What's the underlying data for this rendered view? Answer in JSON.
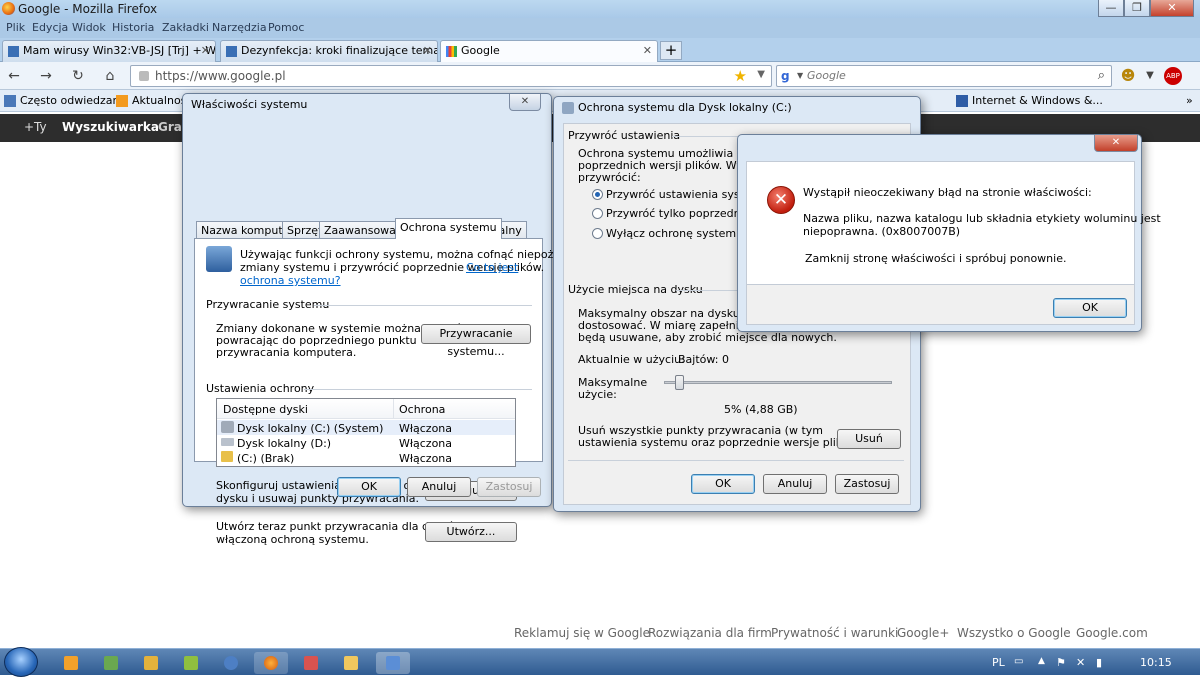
{
  "window": {
    "title": "Google - Mozilla Firefox"
  },
  "menu": [
    "Plik",
    "Edycja",
    "Widok",
    "Historia",
    "Zakładki",
    "Narzędzia",
    "Pomoc"
  ],
  "tabs": [
    {
      "label": "Mam wirusy Win32:VB-JSJ [Trj] + Win..."
    },
    {
      "label": "Dezynfekcja: kroki finalizujące temat ..."
    },
    {
      "label": "Google"
    }
  ],
  "nav": {
    "url": "https://www.google.pl",
    "search_placeholder": "Google"
  },
  "bookmarks": [
    "Często odwiedzane",
    "Aktualności",
    "Internet & Windows &..."
  ],
  "gbar": {
    "plus": "+Ty",
    "search": "Wyszukiwarka",
    "graf": "Graf"
  },
  "footer": [
    "Reklamuj się w Google",
    "Rozwiązania dla firm",
    "Prywatność i warunki",
    "Google+",
    "Wszystko o Google",
    "Google.com"
  ],
  "sysprops": {
    "title": "Właściwości systemu",
    "tabs": [
      "Nazwa komputera",
      "Sprzęt",
      "Zaawansowane",
      "Ochrona systemu",
      "Zdalny"
    ],
    "intro_1": "Używając funkcji ochrony systemu, można cofnąć niepożądane",
    "intro_2": "zmiany systemu i przywrócić poprzednie wersje plików.",
    "intro_link_1": "Co to jest",
    "intro_link_2": "ochrona systemu?",
    "restore_group": "Przywracanie systemu",
    "restore_text_1": "Zmiany dokonane w systemie można cofnąć,",
    "restore_text_2": "powracając do poprzedniego punktu",
    "restore_text_3": "przywracania komputera.",
    "restore_button": "Przywracanie systemu...",
    "prot_group": "Ustawienia ochrony",
    "col_drives": "Dostępne dyski",
    "col_prot": "Ochrona",
    "drives": [
      {
        "name": "Dysk lokalny (C:) (System)",
        "prot": "Włączona"
      },
      {
        "name": "Dysk lokalny (D:)",
        "prot": "Włączona"
      },
      {
        "name": "(C:) (Brak)",
        "prot": "Włączona"
      }
    ],
    "config_text_1": "Skonfiguruj ustawienia, zarządzaj obszarem",
    "config_text_2": "dysku i usuwaj punkty przywracania.",
    "config_button": "Konfiguruj...",
    "create_text_1": "Utwórz teraz punkt przywracania dla dysków z",
    "create_text_2": "włączoną ochroną systemu.",
    "create_button": "Utwórz...",
    "ok": "OK",
    "cancel": "Anuluj",
    "apply": "Zastosuj"
  },
  "protdlg": {
    "title": "Ochrona systemu dla Dysk lokalny (C:)",
    "restore_group": "Przywróć ustawienia",
    "desc_1": "Ochrona systemu umożliwia gromadze",
    "desc_2": "poprzednich wersji plików. Wybierz ele",
    "desc_3": "przywrócić:",
    "opt1": "Przywróć ustawienia systemu o",
    "opt2": "Przywróć tylko poprzednie wers",
    "opt3": "Wyłącz ochronę systemu",
    "usage_group": "Użycie miejsca na dysku",
    "usage_1": "Maksymalny obszar na dysku używany",
    "usage_2": "dostosować. W miarę zapełniania się",
    "usage_3": "będą usuwane, aby zrobić miejsce dla nowych.",
    "current": "Aktualnie w użyciu:",
    "current_val": "Bajtów: 0",
    "max_1": "Maksymalne",
    "max_2": "użycie:",
    "max_val": "5% (4,88 GB)",
    "max_fraction": 0.05,
    "delete_1": "Usuń wszystkie punkty przywracania (w tym",
    "delete_2": "ustawienia systemu oraz poprzednie wersje plików).",
    "delete_button": "Usuń",
    "ok": "OK",
    "cancel": "Anuluj",
    "apply": "Zastosuj"
  },
  "error": {
    "line1": "Wystąpił nieoczekiwany błąd na stronie właściwości:",
    "line2": "Nazwa pliku, nazwa katalogu lub składnia etykiety woluminu jest",
    "line3": "niepoprawna. (0x8007007B)",
    "line4": "Zamknij stronę właściwości i spróbuj ponownie.",
    "ok": "OK"
  },
  "tray": {
    "lang": "PL",
    "time": "10:15"
  }
}
